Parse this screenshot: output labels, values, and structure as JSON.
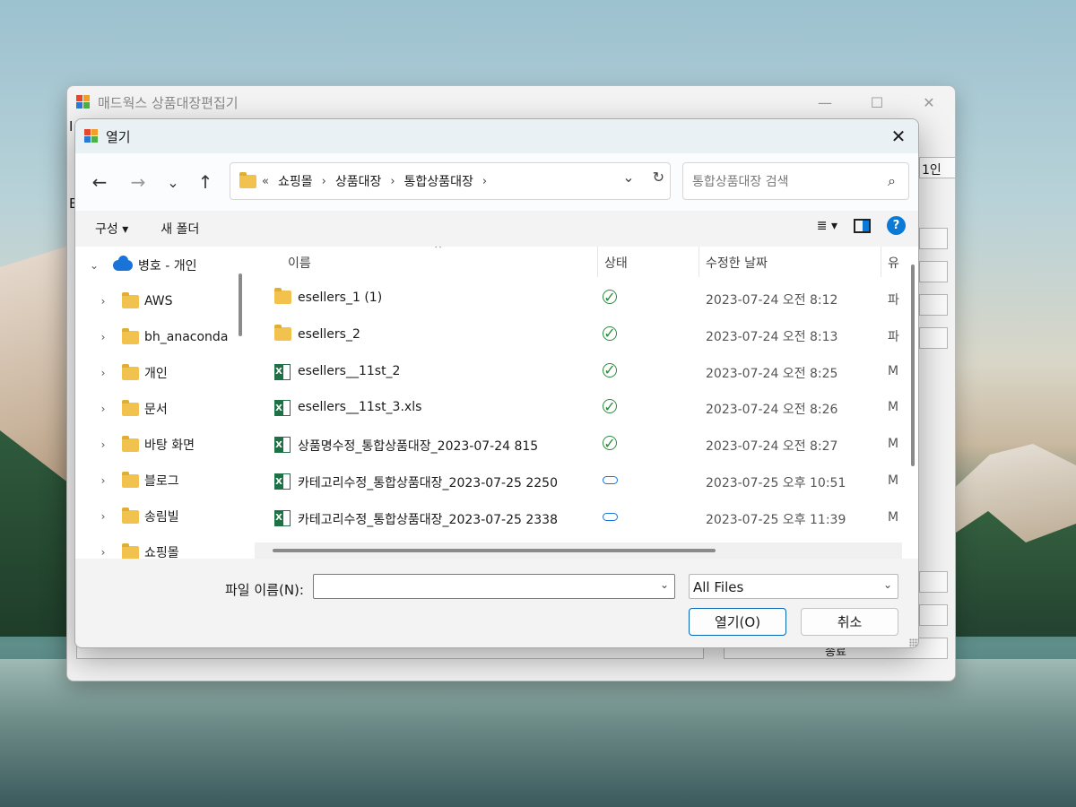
{
  "parent": {
    "title": "매드웍스 상품대장편집기",
    "edge_text_top": "I",
    "edge_text_left": "E",
    "right_button_fragment": "1인",
    "bottom_button_fragment": "종료"
  },
  "dialog": {
    "title": "열기",
    "close_glyph": "✕"
  },
  "navigation": {
    "back": "←",
    "forward": "→",
    "recent": "⌄",
    "up": "↑"
  },
  "address": {
    "overflow": "«",
    "crumbs": [
      "쇼핑몰",
      "상품대장",
      "통합상품대장"
    ],
    "separator": "›",
    "dropdown": "⌄",
    "refresh": "↻"
  },
  "search": {
    "placeholder": "통합상품대장 검색",
    "icon": "⌕"
  },
  "toolbar": {
    "organize": "구성 ▾",
    "new_folder": "새 폴더",
    "view_icon": "≣  ▾"
  },
  "tree": {
    "root": "병호 - 개인",
    "items": [
      "AWS",
      "bh_anaconda",
      "개인",
      "문서",
      "바탕 화면",
      "블로그",
      "송림빌",
      "쇼핑몰"
    ]
  },
  "columns": {
    "name": "이름",
    "status": "상태",
    "modified": "수정한 날짜",
    "type": "유"
  },
  "files": [
    {
      "name": "esellers_1 (1)",
      "kind": "folder",
      "status": "synced",
      "date": "2023-07-24 오전 8:12",
      "type": "파"
    },
    {
      "name": "esellers_2",
      "kind": "folder",
      "status": "synced",
      "date": "2023-07-24 오전 8:13",
      "type": "파"
    },
    {
      "name": "esellers__11st_2",
      "kind": "excel",
      "status": "synced",
      "date": "2023-07-24 오전 8:25",
      "type": "M"
    },
    {
      "name": "esellers__11st_3.xls",
      "kind": "excel",
      "status": "synced",
      "date": "2023-07-24 오전 8:26",
      "type": "M"
    },
    {
      "name": "상품명수정_통합상품대장_2023-07-24 815",
      "kind": "excel",
      "status": "synced",
      "date": "2023-07-24 오전 8:27",
      "type": "M"
    },
    {
      "name": "카테고리수정_통합상품대장_2023-07-25 2250",
      "kind": "excel",
      "status": "cloud",
      "date": "2023-07-25 오후 10:51",
      "type": "M"
    },
    {
      "name": "카테고리수정_통합상품대장_2023-07-25 2338",
      "kind": "excel",
      "status": "cloud",
      "date": "2023-07-25 오후 11:39",
      "type": "M"
    }
  ],
  "footer": {
    "filename_label": "파일 이름(N):",
    "filename_value": "",
    "filetype": "All Files",
    "open": "열기(O)",
    "cancel": "취소"
  },
  "colors": {
    "accent": "#0a7ad6",
    "excel_green": "#1e7145",
    "sync_green": "#2c8a3d",
    "folder_yellow": "#f2c24f"
  }
}
